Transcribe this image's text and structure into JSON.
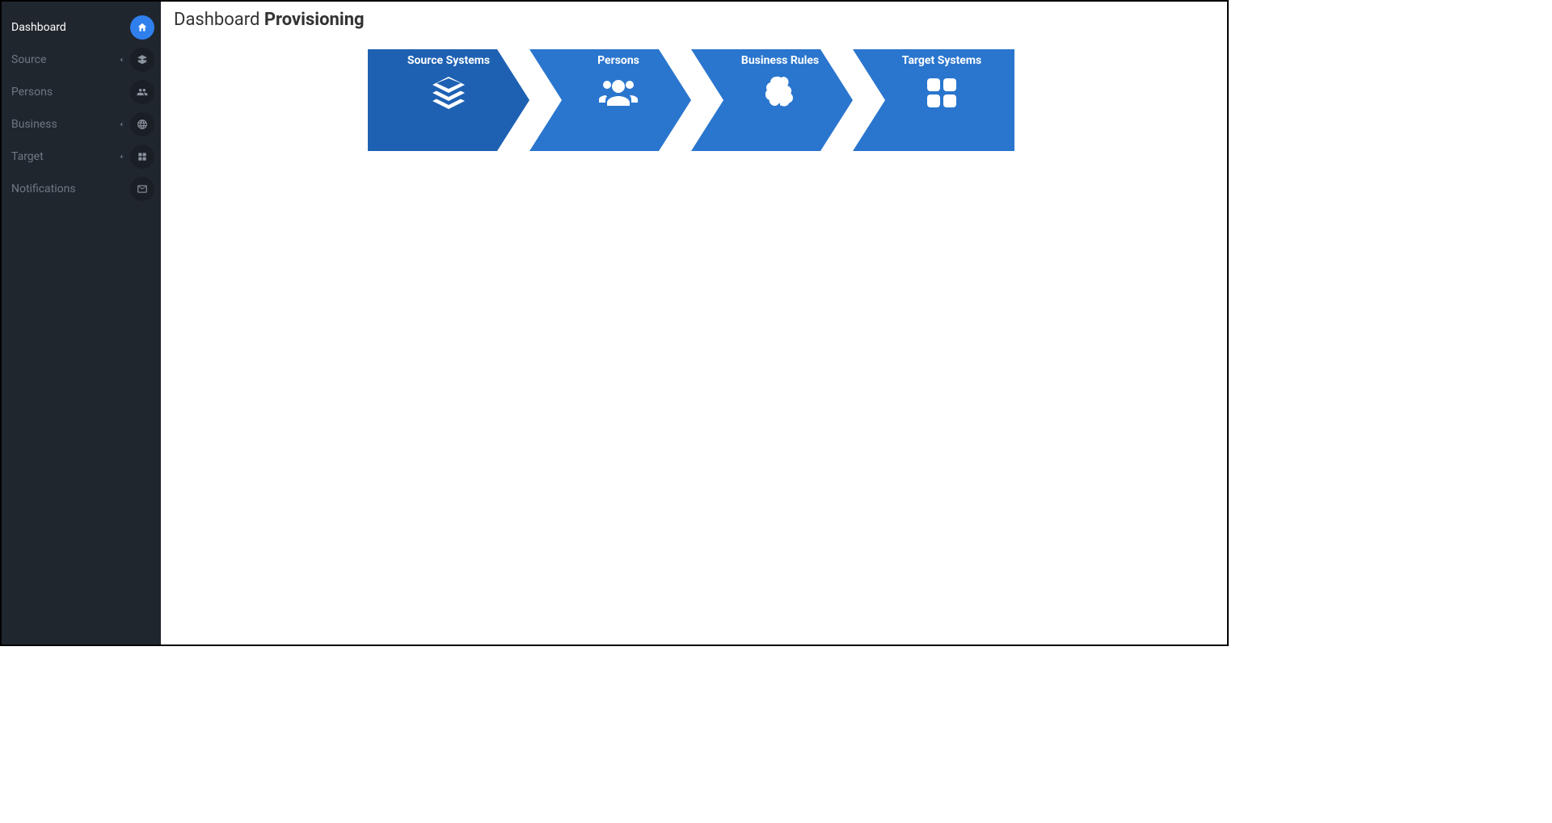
{
  "sidebar": {
    "items": [
      {
        "label": "Dashboard",
        "icon": "home",
        "expandable": false,
        "active": true
      },
      {
        "label": "Source",
        "icon": "layers",
        "expandable": true,
        "active": false
      },
      {
        "label": "Persons",
        "icon": "users",
        "expandable": false,
        "active": false
      },
      {
        "label": "Business",
        "icon": "globe",
        "expandable": true,
        "active": false
      },
      {
        "label": "Target",
        "icon": "grid",
        "expandable": true,
        "active": false
      },
      {
        "label": "Notifications",
        "icon": "envelope",
        "expandable": false,
        "active": false
      }
    ]
  },
  "header": {
    "title_light": "Dashboard",
    "title_bold": "Provisioning"
  },
  "wizard": {
    "steps": [
      {
        "label": "Source Systems",
        "icon": "layers",
        "color": "#1e61b3"
      },
      {
        "label": "Persons",
        "icon": "users",
        "color": "#2a76ce"
      },
      {
        "label": "Business Rules",
        "icon": "brain",
        "color": "#2a76ce"
      },
      {
        "label": "Target Systems",
        "icon": "grid",
        "color": "#2a76ce"
      }
    ]
  }
}
